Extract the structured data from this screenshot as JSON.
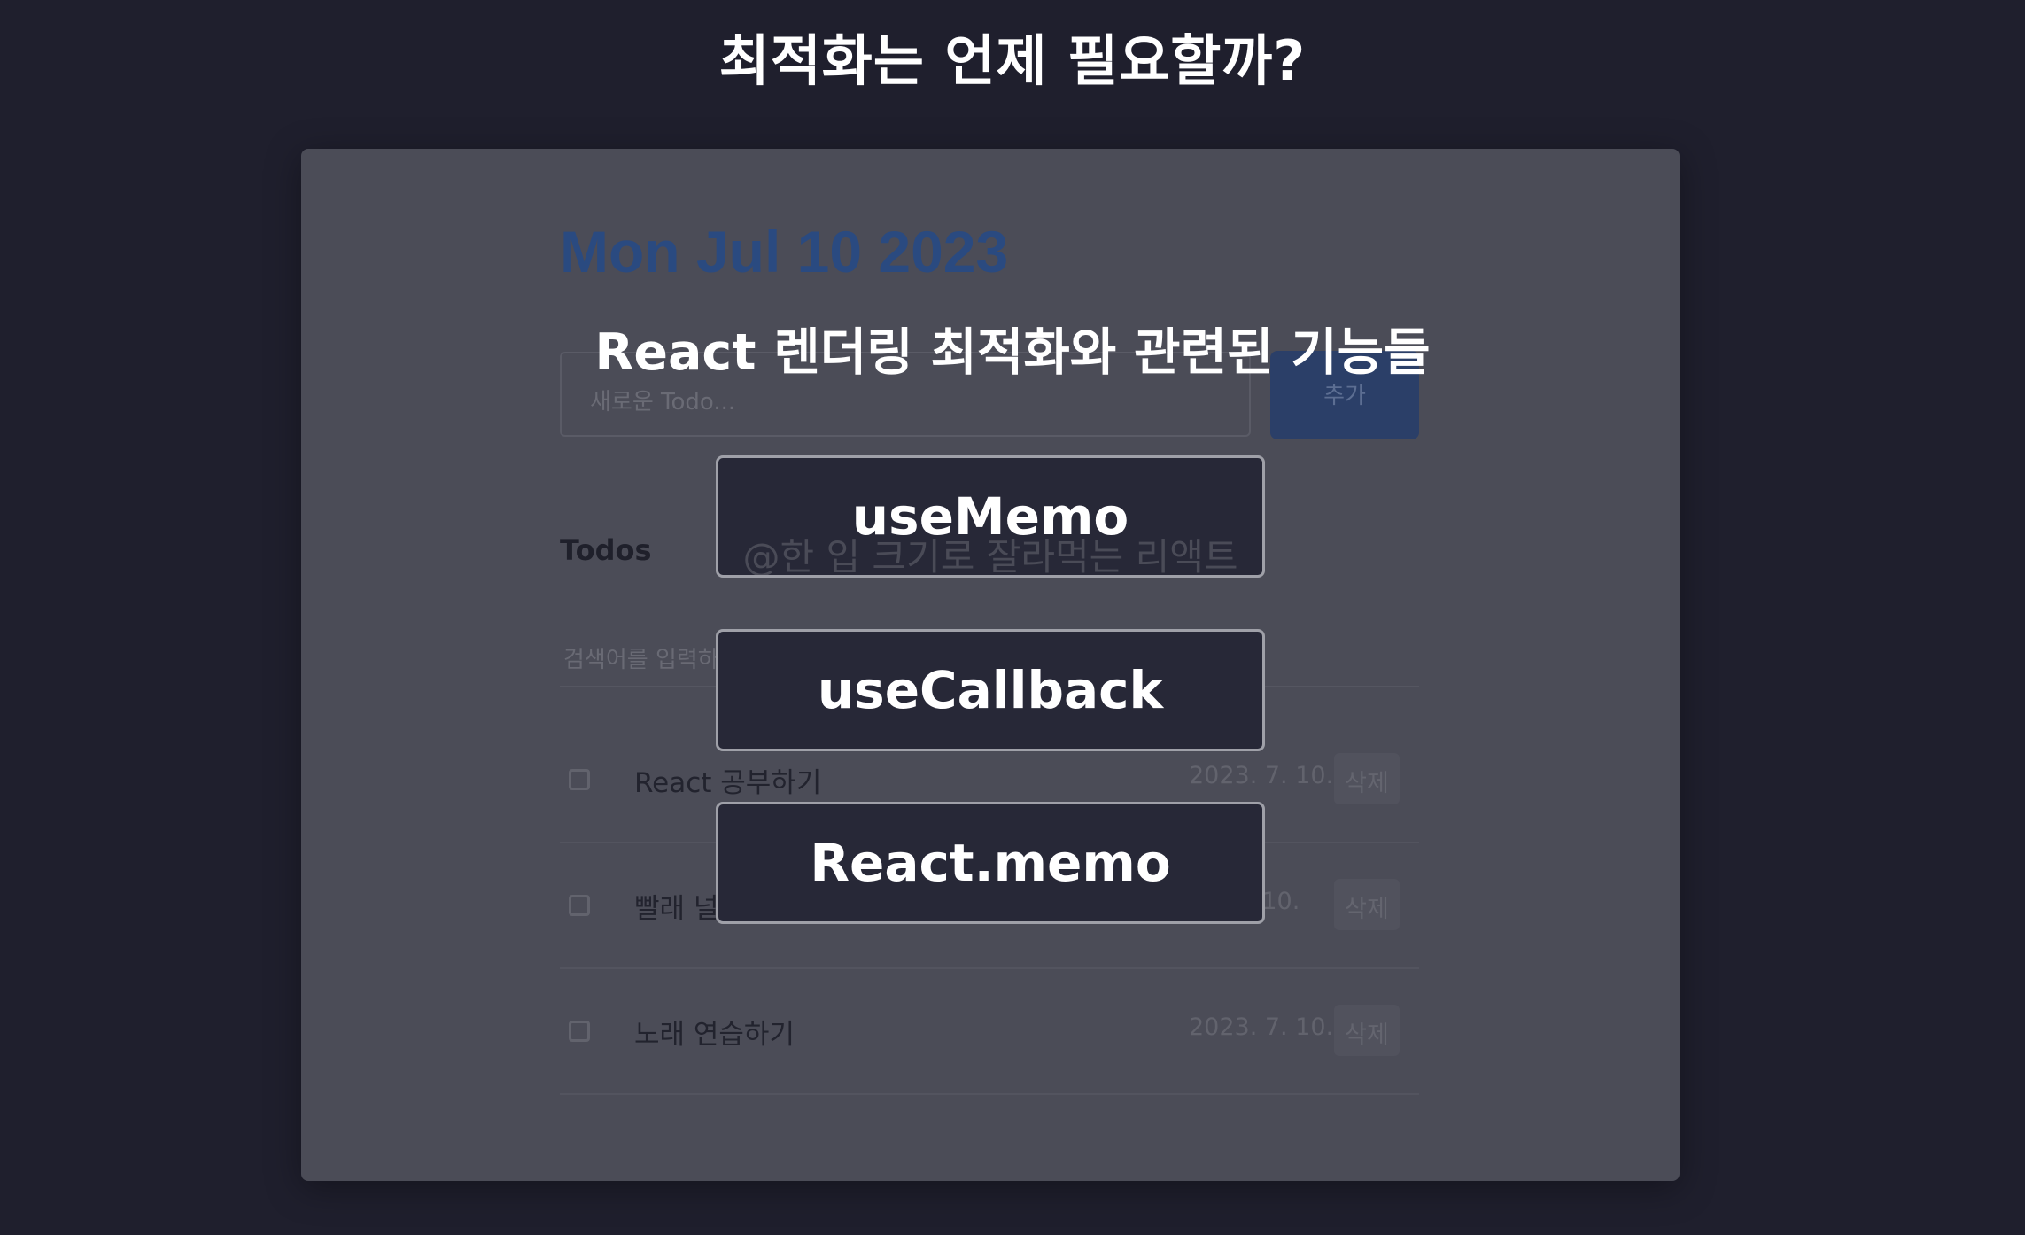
{
  "slide": {
    "title": "최적화는 언제 필요할까?",
    "overlay_heading": "React 렌더링 최적화와 관련된 기능들"
  },
  "app": {
    "date_title": "Mon Jul 10 2023",
    "new_todo_placeholder": "새로운 Todo...",
    "add_label": "추가",
    "todos_heading": "Todos",
    "search_placeholder": "검색어를 입력하",
    "todos": [
      {
        "content": "React 공부하기",
        "date": "2023. 7. 10.",
        "delete_label": "삭제"
      },
      {
        "content": "빨래 널",
        "date": "7. 10.",
        "delete_label": "삭제"
      },
      {
        "content": "노래 연습하기",
        "date": "2023. 7. 10.",
        "delete_label": "삭제"
      }
    ]
  },
  "features": [
    {
      "label": "useMemo"
    },
    {
      "label": "useCallback"
    },
    {
      "label": "React.memo"
    }
  ],
  "watermark": "@한 입 크기로 잘라먹는 리액트",
  "colors": {
    "background": "#1f1f2d",
    "app_panel": "#4b4c57",
    "date_title": "#2a4a80",
    "add_button": "#2b3f68",
    "feature_box": "#272837"
  }
}
